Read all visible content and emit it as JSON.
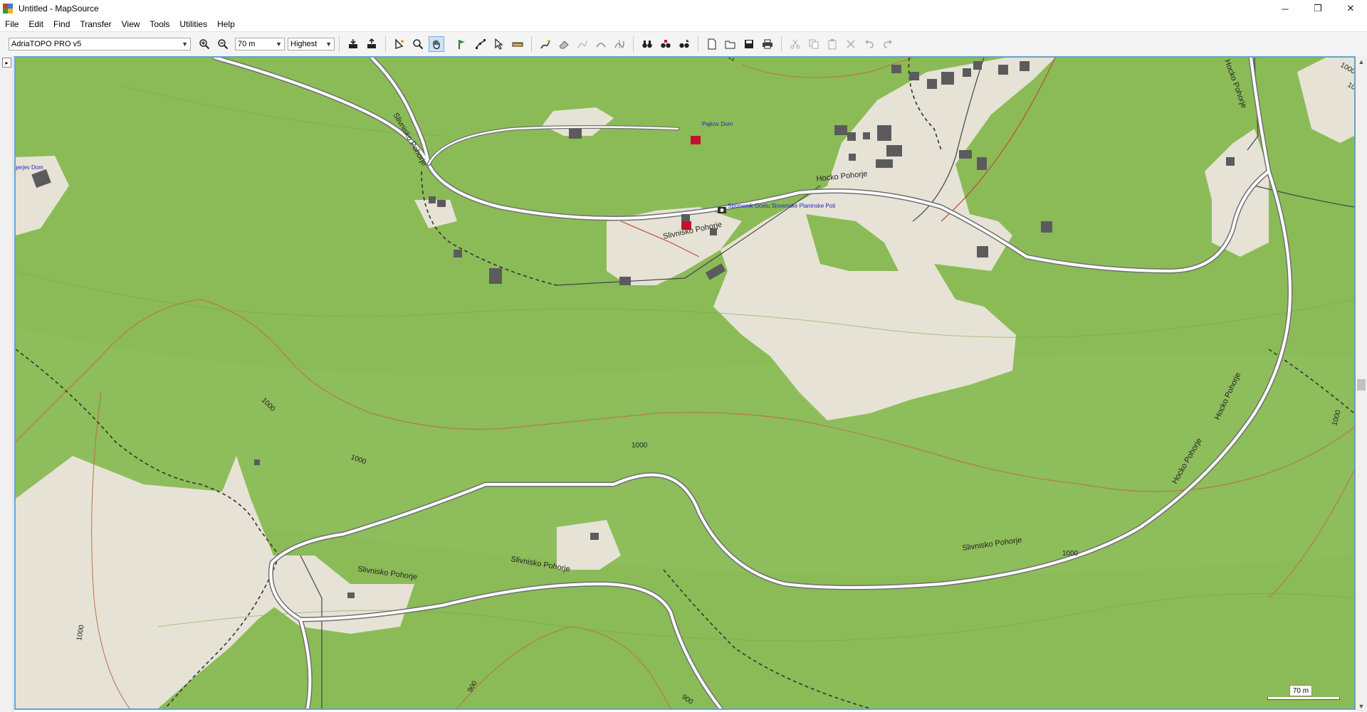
{
  "window": {
    "title": "Untitled - MapSource",
    "minimize": "─",
    "restore": "❐",
    "close": "✕"
  },
  "menu": [
    "File",
    "Edit",
    "Find",
    "Transfer",
    "View",
    "Tools",
    "Utilities",
    "Help"
  ],
  "toolbar": {
    "map_product": "AdriaTOPO PRO v5",
    "zoom_level": "70 m",
    "detail_level": "Highest"
  },
  "map": {
    "labels": {
      "road_slivnisko_1": "Slivnisko Pohorje",
      "road_slivnisko_2": "Slivnisko Pohorje",
      "road_slivnisko_3": "Slivnisko Pohorje",
      "road_slivnisko_4": "Slivnisko Pohorje",
      "road_slivnisko_5": "Slivnisko Pohorje",
      "road_hocko_1": "Hocko Pohorje",
      "road_hocko_2": "Hocko Pohorje",
      "road_hocko_3": "Hocko Pohorje",
      "road_hocko_4": "Hocko Pohorje",
      "poi_pastirski": "Pajkov Dom",
      "poi_monument": "Spomenik Ocetu Slovenske Planinske Poti",
      "poi_left": "gerjev Dom",
      "contour_1": "1000",
      "contour_2": "1000",
      "contour_3": "1000",
      "contour_4": "1000",
      "contour_5": "1000",
      "contour_6": "1000",
      "contour_7": "1000",
      "contour_8": "1000",
      "contour_9": "900",
      "contour_10": "900",
      "contour_11": "11"
    },
    "colors": {
      "forest": "#8bbb57",
      "settlement": "#e6e3d6",
      "building": "#5b5b5e",
      "road_fill": "#ffffff",
      "road_casing": "#707070",
      "contour": "#b8704a",
      "trail": "#333333",
      "poi_red": "#c8102e",
      "poi_text": "#2222cc"
    }
  },
  "scale": {
    "label": "70 m"
  }
}
